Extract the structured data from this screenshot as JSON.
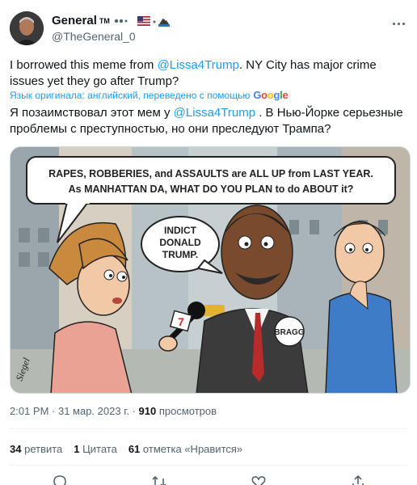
{
  "author": {
    "name": "General",
    "tm": "TM",
    "handle": "@TheGeneral_0"
  },
  "tweet": {
    "text_before": "I borrowed this meme from ",
    "mention": "@Lissa4Trump",
    "text_after": ". NY City has major crime issues yet they go after Trump?"
  },
  "translation": {
    "label": "Язык оригинала: английский, переведено с помощью",
    "provider": "Google",
    "text_before": "Я позаимствовал этот мем у ",
    "mention": "@Lissa4Trump",
    "text_after": " . В Нью-Йорке серьезные проблемы с преступностью, но они преследуют Трампа?"
  },
  "comic": {
    "speech_line1": "RAPES, ROBBERIES, and ASSAULTS are ALL UP from LAST YEAR.",
    "speech_line2": "As MANHATTAN DA, WHAT DO YOU PLAN to do ABOUT it?",
    "reply": [
      "INDICT",
      "DONALD",
      "TRUMP."
    ],
    "badge": "BRAGG",
    "mic_number": "7",
    "credit": "Siegel"
  },
  "meta": {
    "time": "2:01 PM · 31 мар. 2023 г. · ",
    "views": "910",
    "views_label": " просмотров"
  },
  "stats": {
    "retweets": "34",
    "retweets_label": "ретвита",
    "quotes": "1",
    "quotes_label": "Цитата",
    "likes": "61",
    "likes_label": "отметка «Нравится»"
  },
  "colors": {
    "accent": "#1d9bf0",
    "text": "#0f1419",
    "muted": "#536471"
  }
}
